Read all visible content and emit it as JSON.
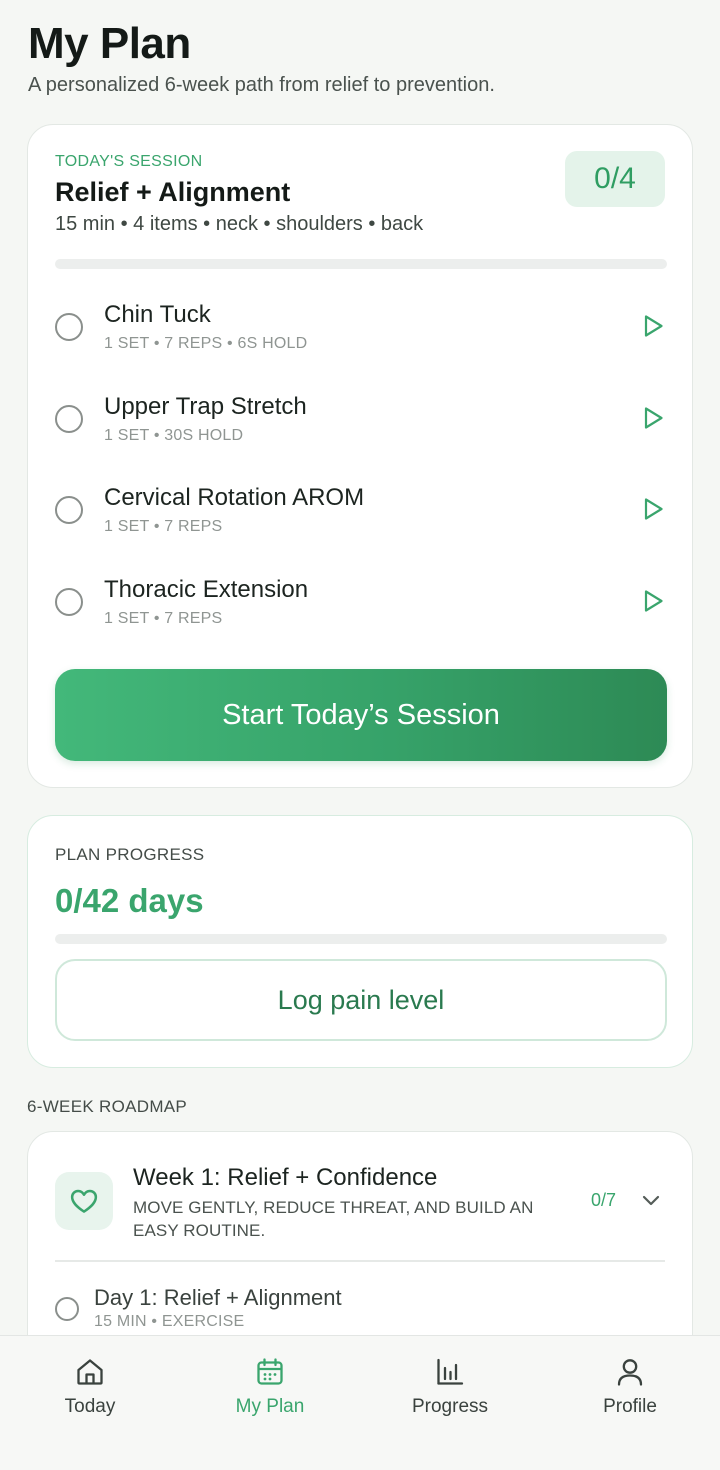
{
  "header": {
    "title": "My Plan",
    "subtitle": "A personalized 6-week path from relief to prevention."
  },
  "session": {
    "eyebrow": "TODAY'S SESSION",
    "title": "Relief + Alignment",
    "meta": "15 min • 4 items • neck • shoulders • back",
    "count": "0/4",
    "progress_fraction": 0,
    "exercises": [
      {
        "name": "Chin Tuck",
        "detail": "1 SET • 7 REPS • 6S HOLD"
      },
      {
        "name": "Upper Trap Stretch",
        "detail": "1 SET • 30S HOLD"
      },
      {
        "name": "Cervical Rotation AROM",
        "detail": "1 SET • 7 REPS"
      },
      {
        "name": "Thoracic Extension",
        "detail": "1 SET • 7 REPS"
      }
    ],
    "start_label": "Start Today’s Session"
  },
  "plan_progress": {
    "eyebrow": "PLAN PROGRESS",
    "days": "0/42 days",
    "progress_fraction": 0,
    "log_label": "Log pain level"
  },
  "roadmap": {
    "label": "6-WEEK ROADMAP",
    "week": {
      "icon": "heart-icon",
      "title": "Week 1: Relief + Confidence",
      "description": "MOVE GENTLY, REDUCE THREAT, AND BUILD AN EASY ROUTINE.",
      "count": "0/7"
    },
    "day": {
      "title": "Day 1: Relief + Alignment",
      "detail": "15 MIN • EXERCISE"
    }
  },
  "nav": {
    "items": [
      {
        "label": "Today",
        "icon": "home-icon"
      },
      {
        "label": "My Plan",
        "icon": "calendar-icon"
      },
      {
        "label": "Progress",
        "icon": "bar-chart-icon"
      },
      {
        "label": "Profile",
        "icon": "user-icon"
      }
    ],
    "active_index": 1
  },
  "colors": {
    "accent": "#3aa56d",
    "accent_dark": "#2d8a55",
    "badge_bg": "#e4f3ea",
    "background": "#f5f7f4"
  }
}
